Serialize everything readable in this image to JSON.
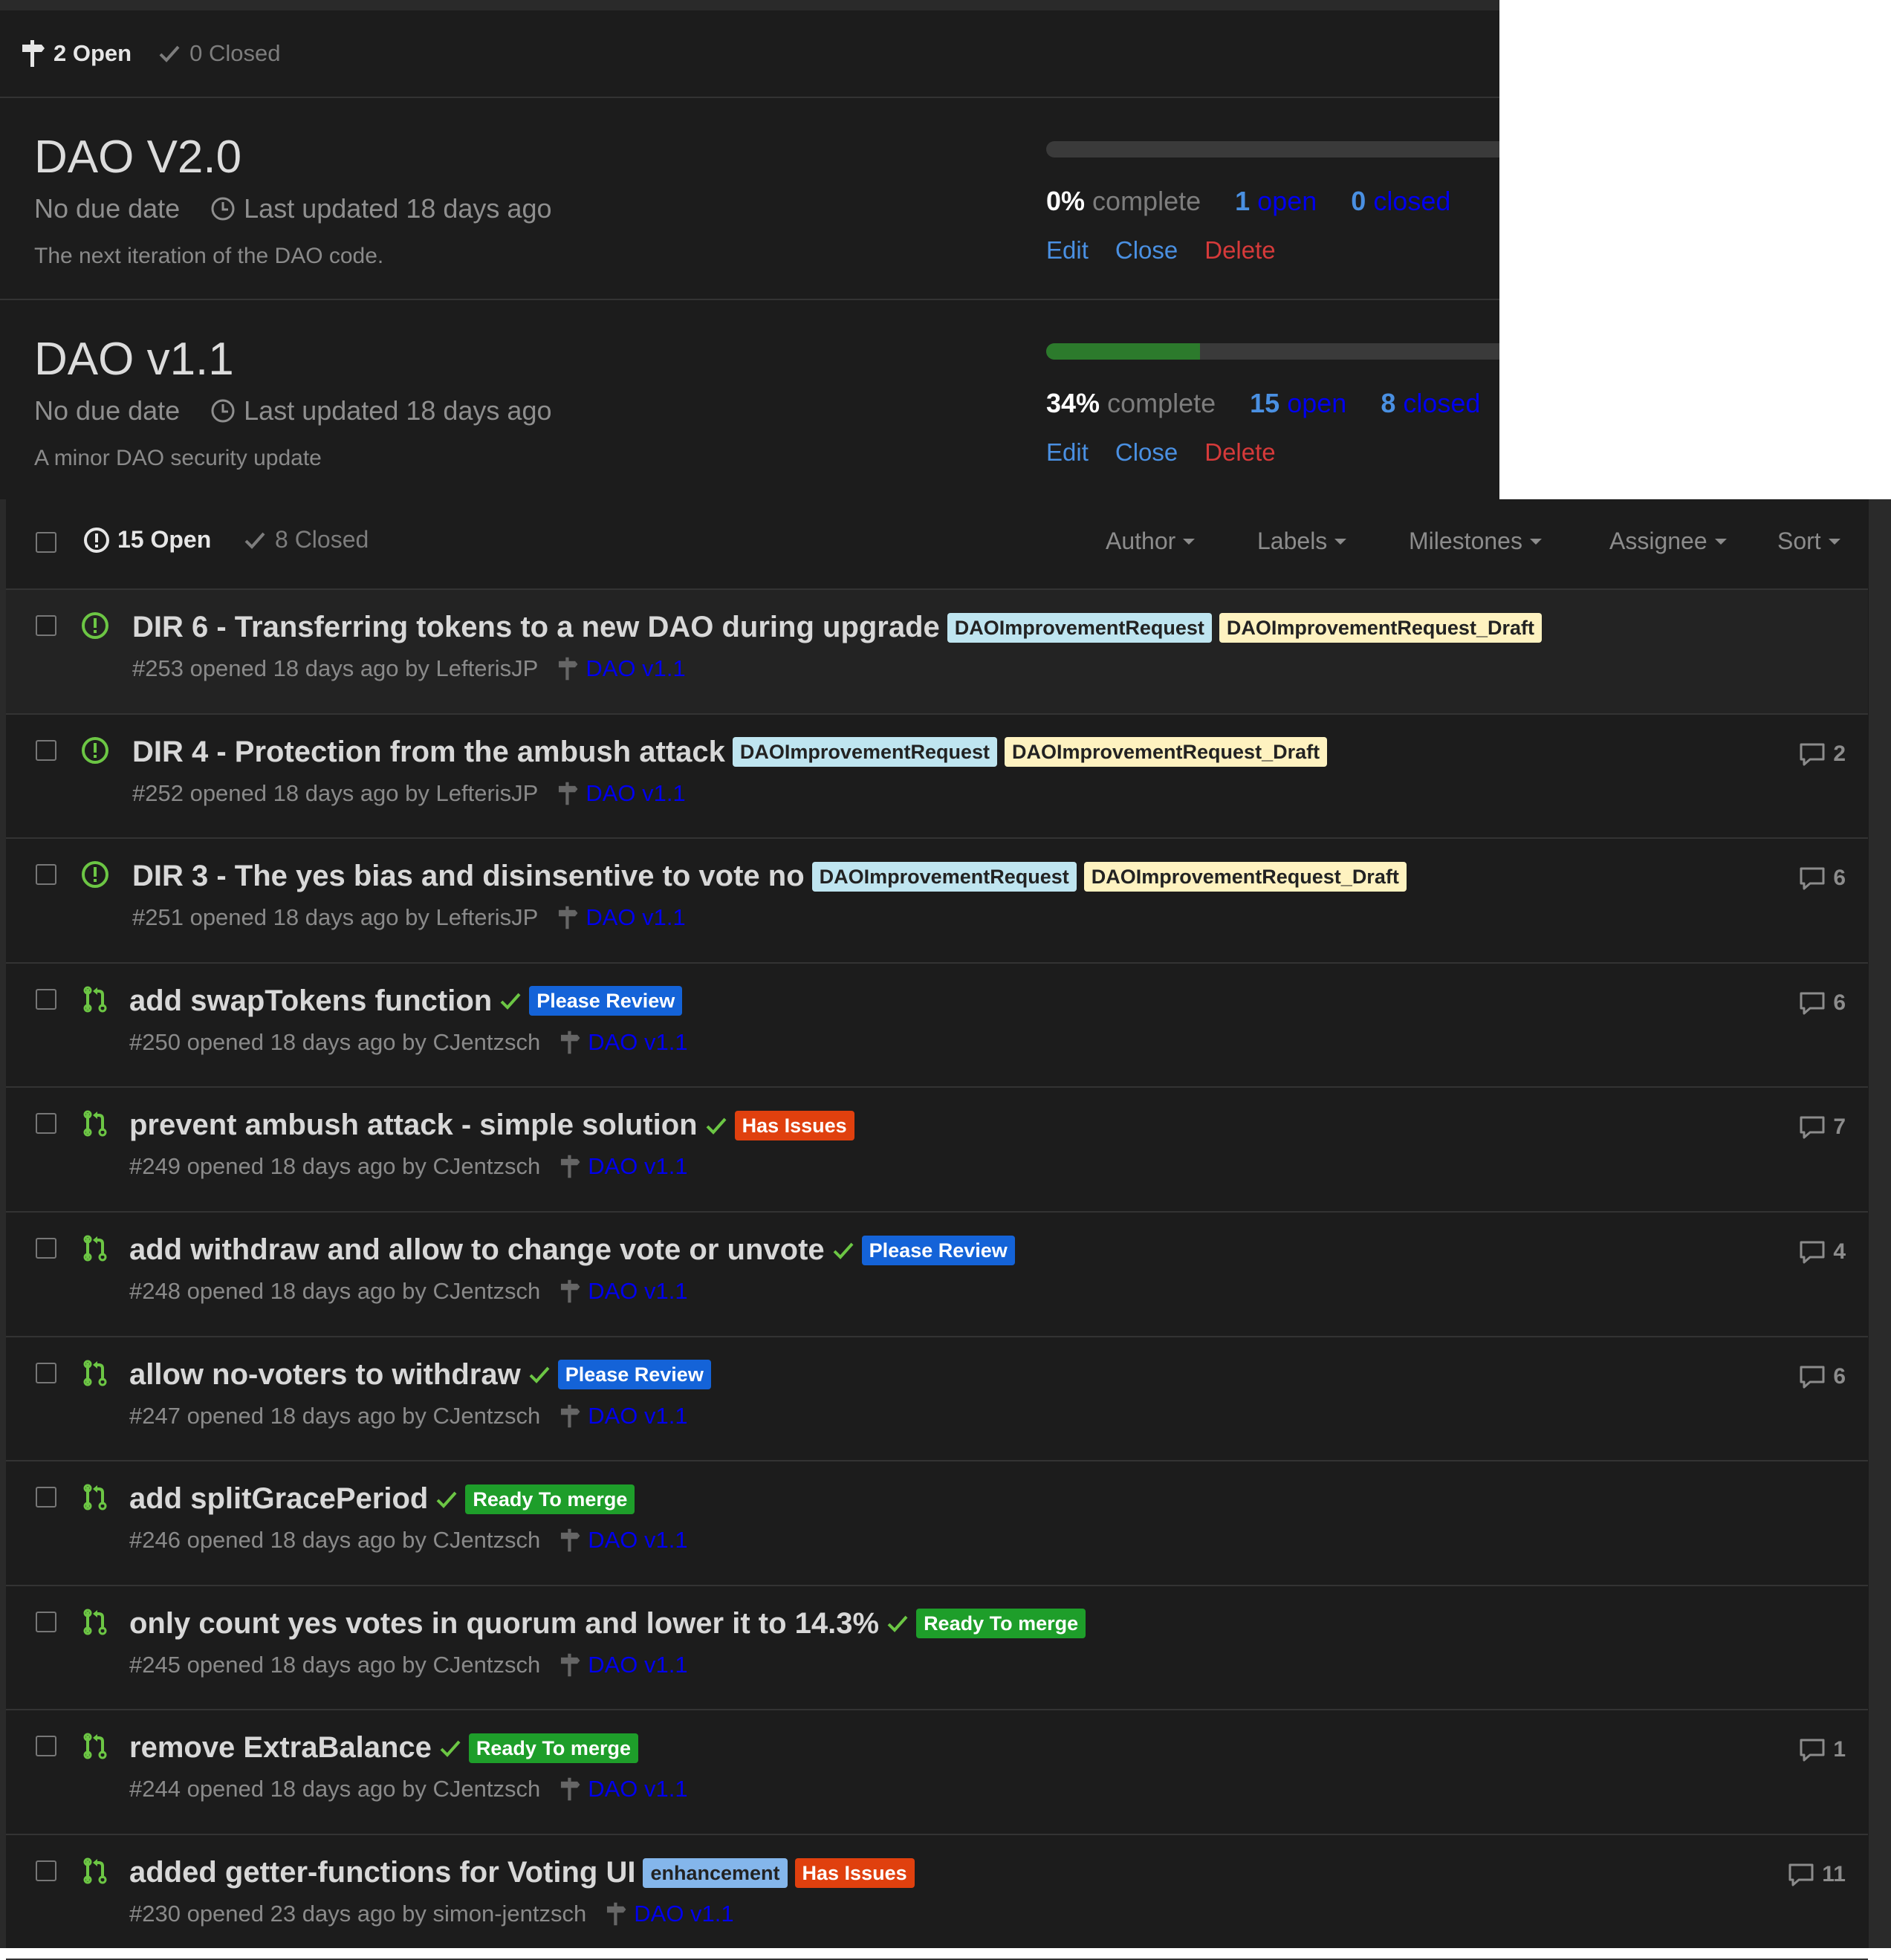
{
  "milestones": {
    "open_label": "2 Open",
    "closed_label": "0 Closed",
    "items": [
      {
        "title": "DAO V2.0",
        "due": "No due date",
        "updated": "Last updated 18 days ago",
        "description": "The next iteration of the DAO code.",
        "progress": 0,
        "pct": "0%",
        "complete_word": "complete",
        "open_count": "1",
        "open_word": "open",
        "closed_count": "0",
        "closed_word": "closed",
        "edit": "Edit",
        "close": "Close",
        "delete": "Delete"
      },
      {
        "title": "DAO v1.1",
        "due": "No due date",
        "updated": "Last updated 18 days ago",
        "description": "A minor DAO security update",
        "progress": 0.34,
        "pct": "34%",
        "complete_word": "complete",
        "open_count": "15",
        "open_word": "open",
        "closed_count": "8",
        "closed_word": "closed",
        "edit": "Edit",
        "close": "Close",
        "delete": "Delete"
      }
    ]
  },
  "issues": {
    "open_label": "15 Open",
    "closed_label": "8 Closed",
    "filters": {
      "author": "Author",
      "labels": "Labels",
      "milestones": "Milestones",
      "assignee": "Assignee",
      "sort": "Sort"
    },
    "rows": [
      {
        "title": "DIR 6 - Transferring tokens to a new DAO during upgrade",
        "kind": "issue",
        "check": false,
        "labels": [
          {
            "text": "DAOImprovementRequest",
            "bg": "#bfe5f0",
            "fg": "#222222"
          },
          {
            "text": "DAOImprovementRequest_Draft",
            "bg": "#fef2c0",
            "fg": "#222222"
          }
        ],
        "meta": "#253 opened 18 days ago by LefterisJP",
        "milestone": "DAO v1.1",
        "comments": ""
      },
      {
        "title": "DIR 4 - Protection from the ambush attack",
        "kind": "issue",
        "check": false,
        "labels": [
          {
            "text": "DAOImprovementRequest",
            "bg": "#bfe5f0",
            "fg": "#222222"
          },
          {
            "text": "DAOImprovementRequest_Draft",
            "bg": "#fef2c0",
            "fg": "#222222"
          }
        ],
        "meta": "#252 opened 18 days ago by LefterisJP",
        "milestone": "DAO v1.1",
        "comments": "2"
      },
      {
        "title": "DIR 3 - The yes bias and disinsentive to vote no",
        "kind": "issue",
        "check": false,
        "labels": [
          {
            "text": "DAOImprovementRequest",
            "bg": "#bfe5f0",
            "fg": "#222222"
          },
          {
            "text": "DAOImprovementRequest_Draft",
            "bg": "#fef2c0",
            "fg": "#222222"
          }
        ],
        "meta": "#251 opened 18 days ago by LefterisJP",
        "milestone": "DAO v1.1",
        "comments": "6"
      },
      {
        "title": "add swapTokens function",
        "kind": "pr",
        "check": true,
        "labels": [
          {
            "text": "Please Review",
            "bg": "#1463d8",
            "fg": "#ffffff"
          }
        ],
        "meta": "#250 opened 18 days ago by CJentzsch",
        "milestone": "DAO v1.1",
        "comments": "6"
      },
      {
        "title": "prevent ambush attack - simple solution",
        "kind": "pr",
        "check": true,
        "labels": [
          {
            "text": "Has Issues",
            "bg": "#e0400e",
            "fg": "#ffffff"
          }
        ],
        "meta": "#249 opened 18 days ago by CJentzsch",
        "milestone": "DAO v1.1",
        "comments": "7"
      },
      {
        "title": "add withdraw and allow to change vote or unvote",
        "kind": "pr",
        "check": true,
        "labels": [
          {
            "text": "Please Review",
            "bg": "#1463d8",
            "fg": "#ffffff"
          }
        ],
        "meta": "#248 opened 18 days ago by CJentzsch",
        "milestone": "DAO v1.1",
        "comments": "4"
      },
      {
        "title": "allow no-voters to withdraw",
        "kind": "pr",
        "check": true,
        "labels": [
          {
            "text": "Please Review",
            "bg": "#1463d8",
            "fg": "#ffffff"
          }
        ],
        "meta": "#247 opened 18 days ago by CJentzsch",
        "milestone": "DAO v1.1",
        "comments": "6"
      },
      {
        "title": "add splitGracePeriod",
        "kind": "pr",
        "check": true,
        "labels": [
          {
            "text": "Ready To merge",
            "bg": "#1e9e2a",
            "fg": "#ffffff"
          }
        ],
        "meta": "#246 opened 18 days ago by CJentzsch",
        "milestone": "DAO v1.1",
        "comments": ""
      },
      {
        "title": "only count yes votes in quorum and lower it to 14.3%",
        "kind": "pr",
        "check": true,
        "labels": [
          {
            "text": "Ready To merge",
            "bg": "#1e9e2a",
            "fg": "#ffffff"
          }
        ],
        "meta": "#245 opened 18 days ago by CJentzsch",
        "milestone": "DAO v1.1",
        "comments": ""
      },
      {
        "title": "remove ExtraBalance",
        "kind": "pr",
        "check": true,
        "labels": [
          {
            "text": "Ready To merge",
            "bg": "#1e9e2a",
            "fg": "#ffffff"
          }
        ],
        "meta": "#244 opened 18 days ago by CJentzsch",
        "milestone": "DAO v1.1",
        "comments": "1"
      },
      {
        "title": "added getter-functions for Voting UI",
        "kind": "pr",
        "check": false,
        "labels": [
          {
            "text": "enhancement",
            "bg": "#84b6eb",
            "fg": "#222222"
          },
          {
            "text": "Has Issues",
            "bg": "#e0400e",
            "fg": "#ffffff"
          }
        ],
        "meta": "#230 opened 23 days ago by simon-jentzsch",
        "milestone": "DAO v1.1",
        "comments": "11"
      }
    ]
  },
  "colors": {
    "background": "#1c1c1c",
    "link_blue": "#4a90e2",
    "delete_red": "#d63a3a",
    "progress_green": "#2c7a2c",
    "open_green": "#6cc644"
  },
  "icons": {
    "milestone": "milestone-icon",
    "check": "check-icon",
    "clock": "clock-icon",
    "issue_open": "issue-opened-icon",
    "pull_request": "git-pull-request-icon",
    "comment": "comment-icon"
  }
}
